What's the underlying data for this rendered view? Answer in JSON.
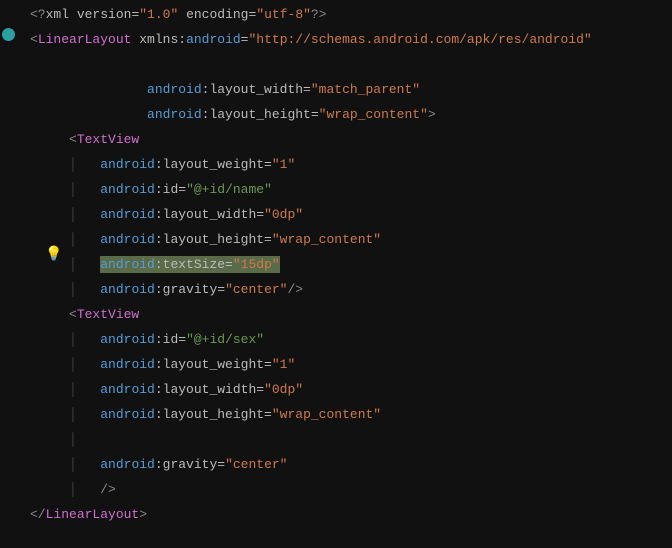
{
  "xml_decl": {
    "open": "<?",
    "name": "xml",
    "ver_attr": "version",
    "ver_val": "\"1.0\"",
    "enc_attr": "encoding",
    "enc_val": "\"utf-8\"",
    "close": "?>"
  },
  "root": {
    "open_b": "<",
    "name": "LinearLayout",
    "xmlns_attr": "xmlns:",
    "xmlns_ns": "android",
    "xmlns_val": "\"http://schemas.android.com/apk/res/android\"",
    "attr1_ns": "android",
    "attr1_name": ":layout_width=",
    "attr1_val": "\"match_parent\"",
    "attr2_ns": "android",
    "attr2_name": ":layout_height=",
    "attr2_val": "\"wrap_content\"",
    "attr2_close": ">",
    "close_open": "</",
    "close_name": "LinearLayout",
    "close_b": ">"
  },
  "tv1": {
    "open_b": "<",
    "name": "TextView",
    "a1_ns": "android",
    "a1_name": ":layout_weight=",
    "a1_val": "\"1\"",
    "a2_ns": "android",
    "a2_name": ":id=",
    "a2_val": "\"@+id/name\"",
    "a3_ns": "android",
    "a3_name": ":layout_width=",
    "a3_val": "\"0dp\"",
    "a4_ns": "android",
    "a4_name": ":layout_height=",
    "a4_val": "\"wrap_content\"",
    "a5_ns": "android",
    "a5_name": ":textSize=",
    "a5_val": "\"15dp\"",
    "a6_ns": "android",
    "a6_name": ":gravity=",
    "a6_val": "\"center\"",
    "close": "/>"
  },
  "tv2": {
    "open_b": "<",
    "name": "TextView",
    "a1_ns": "android",
    "a1_name": ":id=",
    "a1_val": "\"@+id/sex\"",
    "a2_ns": "android",
    "a2_name": ":layout_weight=",
    "a2_val": "\"1\"",
    "a3_ns": "android",
    "a3_name": ":layout_width=",
    "a3_val": "\"0dp\"",
    "a4_ns": "android",
    "a4_name": ":layout_height=",
    "a4_val": "\"wrap_content\"",
    "a5_ns": "android",
    "a5_name": ":gravity=",
    "a5_val": "\"center\"",
    "close": "/>"
  },
  "icons": {
    "bulb": "💡"
  }
}
